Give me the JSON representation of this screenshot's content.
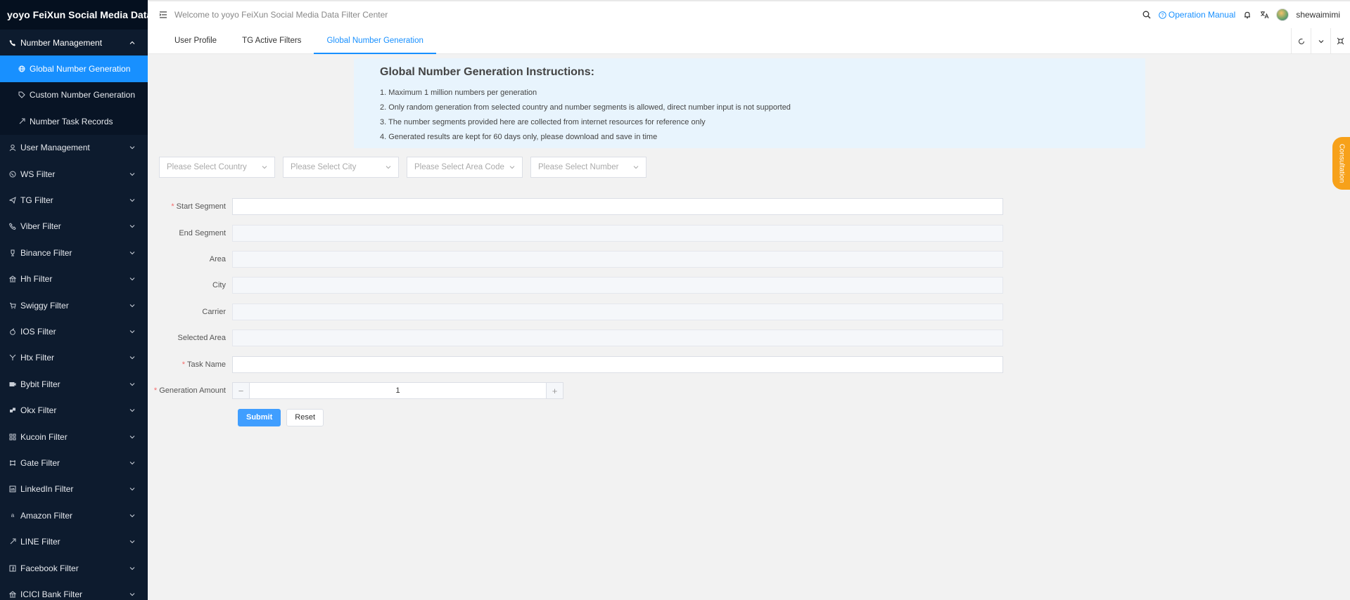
{
  "app": {
    "brand": "yoyo FeiXun Social Media Data F..."
  },
  "header": {
    "welcome": "Welcome to yoyo FeiXun Social Media Data Filter Center",
    "operation_manual": "Operation Manual",
    "username": "shewaimimi"
  },
  "sidebar": {
    "open_group": {
      "label": "Number Management",
      "icon": "phone-icon",
      "children": [
        {
          "label": "Global Number Generation",
          "icon": "globe-icon",
          "active": true
        },
        {
          "label": "Custom Number Generation",
          "icon": "tag-icon"
        },
        {
          "label": "Number Task Records",
          "icon": "link-icon"
        }
      ]
    },
    "items": [
      {
        "label": "User Management",
        "icon": "user-icon"
      },
      {
        "label": "WS Filter",
        "icon": "whatsapp-icon"
      },
      {
        "label": "TG Filter",
        "icon": "telegram-icon"
      },
      {
        "label": "Viber Filter",
        "icon": "viber-icon"
      },
      {
        "label": "Binance Filter",
        "icon": "trophy-icon"
      },
      {
        "label": "Hh Filter",
        "icon": "bank-icon"
      },
      {
        "label": "Swiggy Filter",
        "icon": "cart-icon"
      },
      {
        "label": "IOS Filter",
        "icon": "apple-icon"
      },
      {
        "label": "Htx Filter",
        "icon": "filter-icon"
      },
      {
        "label": "Bybit Filter",
        "icon": "camera-icon"
      },
      {
        "label": "Okx Filter",
        "icon": "grid-icon"
      },
      {
        "label": "Kucoin Filter",
        "icon": "apps-icon"
      },
      {
        "label": "Gate Filter",
        "icon": "gate-icon"
      },
      {
        "label": "LinkedIn Filter",
        "icon": "linkedin-icon"
      },
      {
        "label": "Amazon Filter",
        "icon": "amazon-icon"
      },
      {
        "label": "LINE Filter",
        "icon": "line-icon"
      },
      {
        "label": "Facebook Filter",
        "icon": "facebook-icon"
      },
      {
        "label": "ICICI Bank Filter",
        "icon": "bank-icon"
      }
    ]
  },
  "tabs": [
    {
      "label": "User Profile"
    },
    {
      "label": "TG Active Filters"
    },
    {
      "label": "Global Number Generation",
      "active": true
    }
  ],
  "instructions": {
    "title": "Global Number Generation Instructions:",
    "lines": [
      "1. Maximum 1 million numbers per generation",
      "2. Only random generation from selected country and number segments is allowed, direct number input is not supported",
      "3. The number segments provided here are collected from internet resources for reference only",
      "4. Generated results are kept for 60 days only, please download and save in time"
    ]
  },
  "selects": {
    "country": "Please Select Country",
    "city": "Please Select City",
    "area_code": "Please Select Area Code",
    "number": "Please Select Number"
  },
  "form": {
    "start_segment": {
      "label": "Start Segment",
      "value": "",
      "required": true
    },
    "end_segment": {
      "label": "End Segment",
      "value": ""
    },
    "area": {
      "label": "Area",
      "value": ""
    },
    "city": {
      "label": "City",
      "value": ""
    },
    "carrier": {
      "label": "Carrier",
      "value": ""
    },
    "selected_area": {
      "label": "Selected Area",
      "value": ""
    },
    "task_name": {
      "label": "Task Name",
      "value": "",
      "required": true
    },
    "generation_amount": {
      "label": "Generation Amount",
      "value": "1",
      "required": true
    },
    "required_mark": "*",
    "submit": "Submit",
    "reset": "Reset"
  },
  "consult": "Consultation",
  "colors": {
    "primary": "#1890ff",
    "sidebar": "#0d1b2e",
    "accent": "#f7a11a",
    "required": "#f56c6c"
  }
}
